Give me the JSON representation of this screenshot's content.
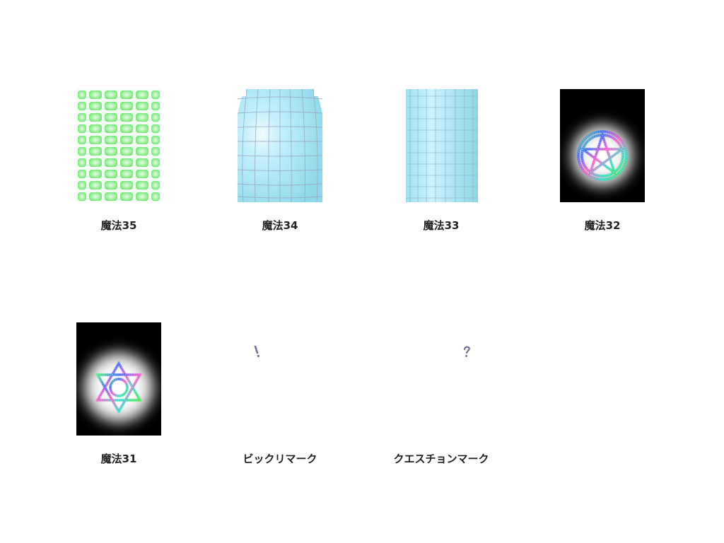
{
  "gallery": {
    "items": [
      {
        "label": "魔法35",
        "image": "green-grid-barrel-icon"
      },
      {
        "label": "魔法34",
        "image": "blue-grid-barrel-icon"
      },
      {
        "label": "魔法33",
        "image": "blue-grid-cylinder-icon"
      },
      {
        "label": "魔法32",
        "image": "glowing-pentagram-circle-icon"
      },
      {
        "label": "魔法31",
        "image": "glowing-hexagram-circle-icon"
      },
      {
        "label": "ビックリマーク",
        "image": "exclamation-mark-icon"
      },
      {
        "label": "クエスチョンマーク",
        "image": "question-mark-icon"
      }
    ]
  },
  "colors": {
    "green_tile": "#80ee80",
    "green_bg": "#eafaea",
    "sky_blue": "#aeeaf6",
    "grid_line": "#9aa6c8",
    "black": "#000000",
    "caption_text": "#222222"
  }
}
